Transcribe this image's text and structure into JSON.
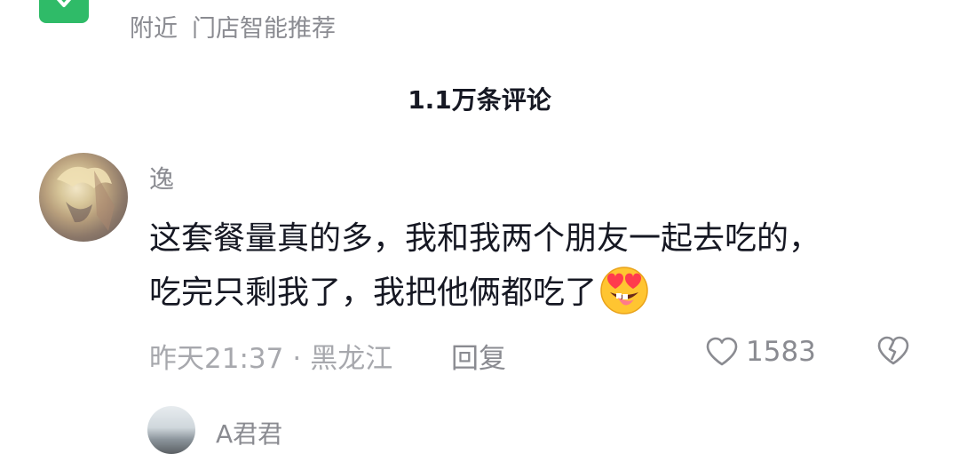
{
  "topbar": {
    "nearby_label": "附近",
    "store_recommend": "门店智能推荐",
    "icon": "location-pin-icon",
    "accent": "#2fbb68"
  },
  "header": {
    "comment_count_title": "1.1万条评论"
  },
  "comments": [
    {
      "username": "逸",
      "text_line1": "这套餐量真的多，我和我两个朋友一起去吃的，",
      "text_line2": "吃完只剩我了，我把他俩都吃了",
      "emoji": "heart-eyes-tongue-emoji",
      "time": "昨天21:37",
      "separator": "·",
      "location": "黑龙江",
      "reply_label": "回复",
      "likes": "1583",
      "like_icon": "heart-outline-icon",
      "dislike_icon": "broken-heart-icon"
    },
    {
      "username": "A君君"
    }
  ],
  "colors": {
    "text_primary": "#161823",
    "text_secondary": "#8a8b91",
    "text_meta": "#a7a8ad"
  }
}
